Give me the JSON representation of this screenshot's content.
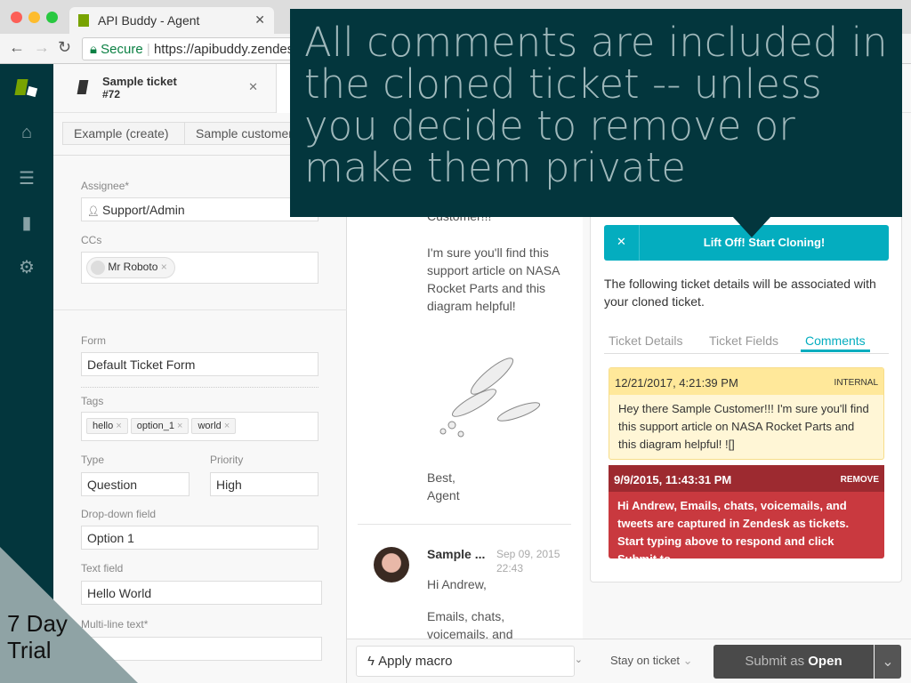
{
  "browser": {
    "tab_title": "API Buddy - Agent",
    "secure_label": "Secure",
    "url": "https://apibuddy.zendesk.com"
  },
  "nav": {
    "icons": [
      "zendesk-logo",
      "home-icon",
      "views-icon",
      "reporting-icon",
      "settings-icon"
    ]
  },
  "ticket_tab": {
    "title": "Sample ticket",
    "number": "#72"
  },
  "toolbar": {
    "buttons": [
      "Example (create)",
      "Sample customer"
    ]
  },
  "form": {
    "assignee_label": "Assignee*",
    "assignee": "Support/Admin",
    "ccs_label": "CCs",
    "ccs": [
      "Mr Roboto"
    ],
    "form_label": "Form",
    "form_value": "Default Ticket Form",
    "tags_label": "Tags",
    "tags": [
      "hello",
      "option_1",
      "world"
    ],
    "type_label": "Type",
    "type_value": "Question",
    "priority_label": "Priority",
    "priority_value": "High",
    "dropdown_label": "Drop-down field",
    "dropdown_value": "Option 1",
    "text_label": "Text field",
    "text_value": "Hello World",
    "multiline_label": "Multi-line text*"
  },
  "conversation": {
    "c1_top": "Customer!!!",
    "c1_body": "I'm sure you'll find this support article on NASA Rocket Parts and this diagram helpful!",
    "c1_sign1": "Best,",
    "c1_sign2": "Agent",
    "c2_author": "Sample ...",
    "c2_date": "Sep 09, 2015 22:43",
    "c2_line1": "Hi Andrew,",
    "c2_line2": "Emails, chats, voicemails, and"
  },
  "clone": {
    "lift_a": "Lift Off!",
    "lift_b": "Start Cloning!",
    "intro": "The following ticket details will be associated with your cloned ticket.",
    "tabs": [
      "Ticket Details",
      "Ticket Fields",
      "Comments"
    ],
    "active_tab": "Comments",
    "comments": [
      {
        "date": "12/21/2017, 4:21:39 PM",
        "badge": "INTERNAL",
        "body": "Hey there Sample Customer!!! I'm sure you'll find this support article on NASA Rocket Parts and this diagram helpful!  ![]"
      },
      {
        "date": "9/9/2015, 11:43:31 PM",
        "badge": "REMOVE",
        "body": "Hi Andrew, Emails, chats, voicemails, and tweets are captured in Zendesk as tickets. Start typing above to respond and click Submit to"
      }
    ]
  },
  "footer": {
    "macro": "Apply macro",
    "stay": "Stay on ticket",
    "submit_a": "Submit as",
    "submit_b": "Open"
  },
  "overlay": {
    "text": "All comments are included in the cloned ticket -- unless you decide to remove or make them private"
  },
  "trial": {
    "line1": "7 Day",
    "line2": "Trial"
  },
  "colors": {
    "nav": "#03363d",
    "accent": "#04adbf",
    "internal": "#ffe89a",
    "remove": "#c9393f"
  }
}
